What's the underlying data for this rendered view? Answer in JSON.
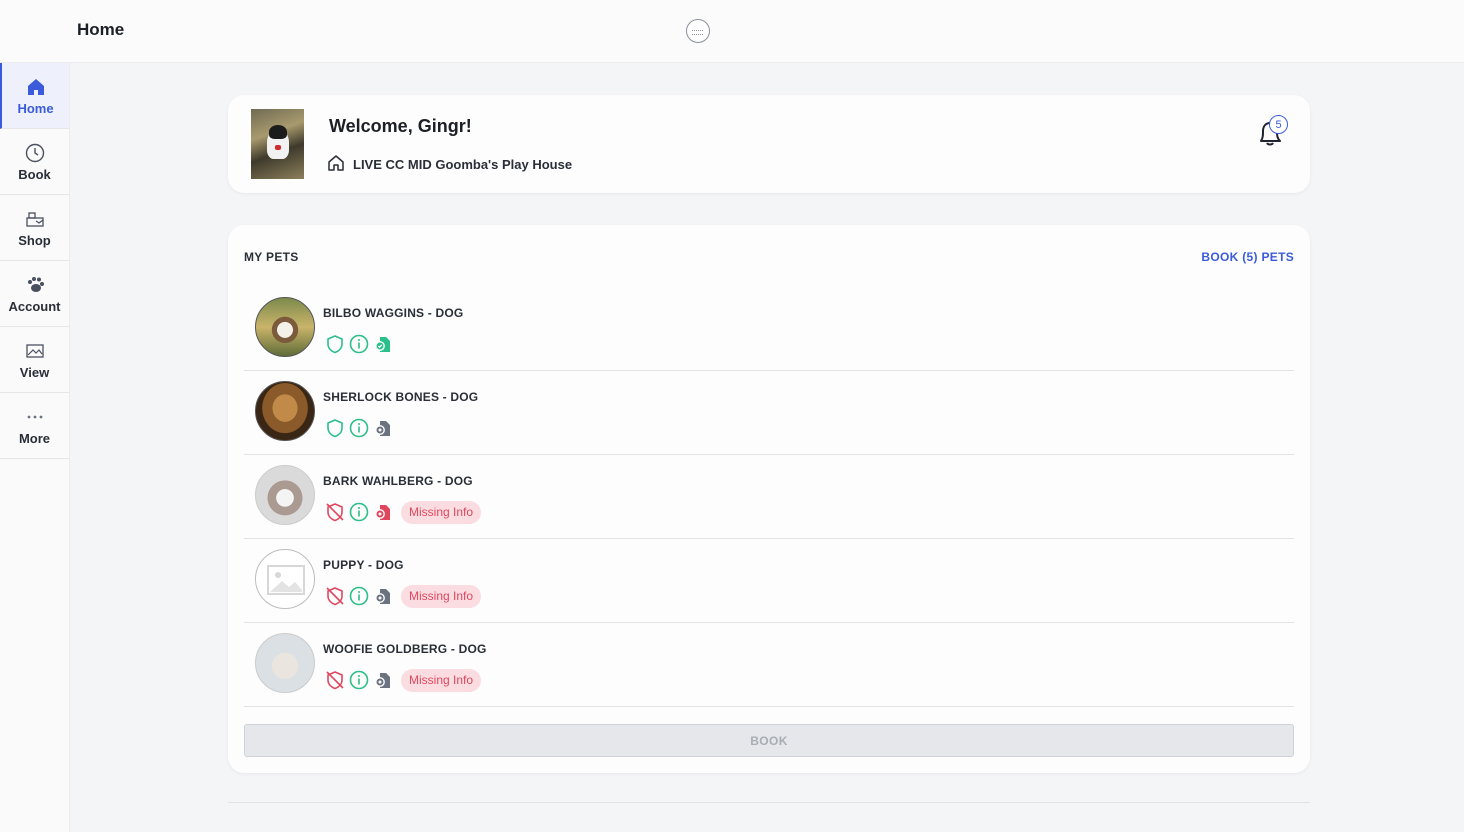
{
  "header": {
    "title": "Home"
  },
  "sidebar": {
    "items": [
      {
        "label": "Home",
        "icon": "home-icon",
        "active": true
      },
      {
        "label": "Book",
        "icon": "clock-icon",
        "active": false
      },
      {
        "label": "Shop",
        "icon": "shop-icon",
        "active": false
      },
      {
        "label": "Account",
        "icon": "paw-icon",
        "active": false
      },
      {
        "label": "View",
        "icon": "image-icon",
        "active": false
      },
      {
        "label": "More",
        "icon": "more-icon",
        "active": false
      }
    ]
  },
  "welcome": {
    "greeting": "Welcome, Gingr!",
    "location": "LIVE CC MID Goomba's Play House",
    "notification_count": "5"
  },
  "pets": {
    "heading": "MY PETS",
    "book_link": "BOOK (5) PETS",
    "list": [
      {
        "name": "BILBO WAGGINS - DOG",
        "vaccines_ok": true,
        "docs_ok": true,
        "missing_info": ""
      },
      {
        "name": "SHERLOCK BONES - DOG",
        "vaccines_ok": true,
        "docs_ok": false,
        "missing_info": ""
      },
      {
        "name": "BARK WAHLBERG - DOG",
        "vaccines_ok": false,
        "docs_ok": false,
        "missing_info": "Missing Info"
      },
      {
        "name": "PUPPY - DOG",
        "vaccines_ok": false,
        "docs_ok": false,
        "missing_info": "Missing Info"
      },
      {
        "name": "WOOFIE GOLDBERG - DOG",
        "vaccines_ok": false,
        "docs_ok": false,
        "missing_info": "Missing Info"
      }
    ],
    "book_button": "BOOK"
  },
  "colors": {
    "accent": "#3b5bdb",
    "success": "#2bbf8a",
    "danger": "#e0475e",
    "neutral_icon": "#6b7280"
  }
}
